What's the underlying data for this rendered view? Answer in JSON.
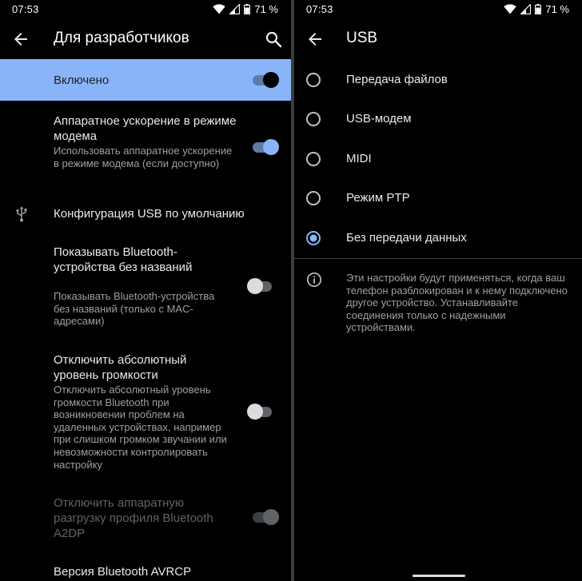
{
  "left": {
    "status": {
      "time": "07:53",
      "battery": "71 %"
    },
    "title": "Для разработчиков",
    "master": {
      "label": "Включено",
      "state": "on"
    },
    "items": [
      {
        "title": "Аппаратное ускорение в режиме модема",
        "summary": "Использовать аппаратное ускорение в режиме модема (если доступно)",
        "toggle": "on"
      },
      {
        "title": "Конфигурация USB по умолчанию",
        "icon": "usb-icon"
      },
      {
        "title": "Показывать Bluetooth-устройства без названий",
        "summary": "Показывать Bluetooth-устройства без названий (только с MAC-адресами)",
        "toggle": "off"
      },
      {
        "title": "Отключить абсолютный уровень громкости",
        "summary": "Отключить абсолютный уровень громкости Bluetooth при возникновении проблем на удаленных устройствах, например при слишком громком звучании или невозможности контролировать настройку",
        "toggle": "off"
      },
      {
        "title": "Отключить аппаратную разгрузку профиля Bluetooth A2DP",
        "toggle": "on",
        "disabled": true
      },
      {
        "title": "Версия Bluetooth AVRCP"
      }
    ]
  },
  "right": {
    "status": {
      "time": "07:53",
      "battery": "71 %"
    },
    "title": "USB",
    "options": [
      {
        "label": "Передача файлов",
        "selected": false
      },
      {
        "label": "USB-модем",
        "selected": false
      },
      {
        "label": "MIDI",
        "selected": false
      },
      {
        "label": "Режим PTP",
        "selected": false
      },
      {
        "label": "Без передачи данных",
        "selected": true
      }
    ],
    "info": "Эти настройки будут применяться, когда ваш телефон разблокирован и к нему подключено другое устройство. Устанавливайте соединения только с надежными устройствами."
  },
  "colors": {
    "accent": "#8ab4f8",
    "background": "#000000",
    "text": "#e8eaed",
    "secondary_text": "#9aa0a6"
  }
}
